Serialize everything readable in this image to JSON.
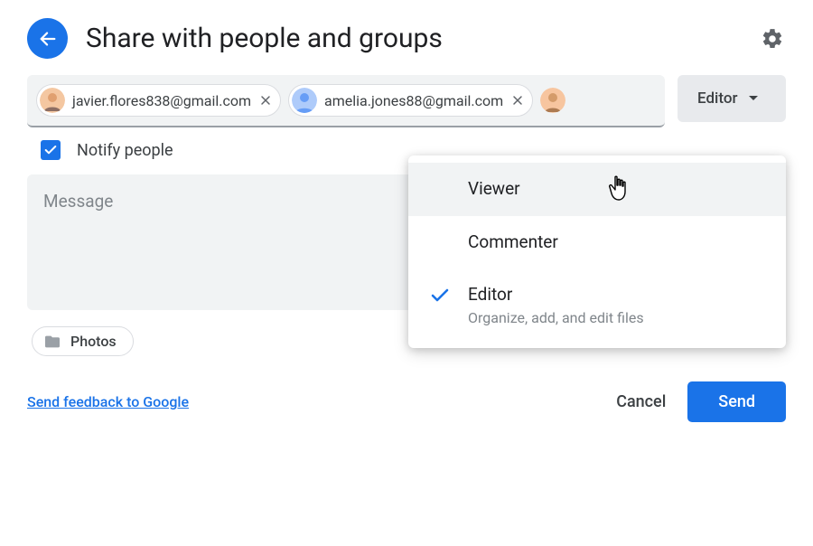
{
  "header": {
    "title": "Share with people and groups"
  },
  "people": {
    "chips": [
      {
        "email": "javier.flores838@gmail.com"
      },
      {
        "email": "amelia.jones88@gmail.com"
      }
    ]
  },
  "role_selector": {
    "label": "Editor",
    "options": [
      {
        "label": "Viewer",
        "subtitle": "",
        "selected": false,
        "hover": true
      },
      {
        "label": "Commenter",
        "subtitle": "",
        "selected": false,
        "hover": false
      },
      {
        "label": "Editor",
        "subtitle": "Organize, add, and edit files",
        "selected": true,
        "hover": false
      }
    ]
  },
  "notify": {
    "label": "Notify people",
    "checked": true
  },
  "message": {
    "placeholder": "Message"
  },
  "attachment": {
    "name": "Photos"
  },
  "footer": {
    "feedback": "Send feedback to Google",
    "cancel": "Cancel",
    "send": "Send"
  }
}
